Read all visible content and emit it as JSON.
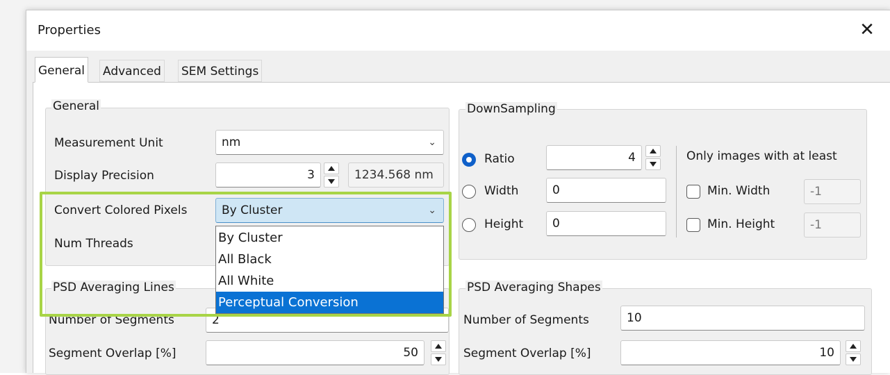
{
  "dialog": {
    "title": "Properties",
    "close_glyph": "✕"
  },
  "tabs": [
    {
      "label": "General",
      "active": true
    },
    {
      "label": "Advanced",
      "active": false
    },
    {
      "label": "SEM Settings",
      "active": false
    }
  ],
  "general_group": {
    "legend": "General",
    "measurement_unit": {
      "label": "Measurement Unit",
      "value": "nm"
    },
    "display_precision": {
      "label": "Display Precision",
      "value": "3",
      "preview": "1234.568 nm"
    },
    "convert_colored_pixels": {
      "label": "Convert Colored Pixels",
      "value": "By Cluster",
      "options": [
        "By Cluster",
        "All Black",
        "All White",
        "Perceptual Conversion"
      ],
      "highlighted_option": "Perceptual Conversion"
    },
    "num_threads": {
      "label": "Num Threads"
    }
  },
  "downsampling_group": {
    "legend": "DownSampling",
    "ratio": {
      "label": "Ratio",
      "value": "4",
      "selected": true
    },
    "width": {
      "label": "Width",
      "value": "0",
      "selected": false
    },
    "height": {
      "label": "Height",
      "value": "0",
      "selected": false
    },
    "only_images_label": "Only images with at least",
    "min_width": {
      "label": "Min. Width",
      "value": "-1",
      "checked": false
    },
    "min_height": {
      "label": "Min. Height",
      "value": "-1",
      "checked": false
    }
  },
  "psd_lines_group": {
    "legend": "PSD Averaging Lines",
    "number_of_segments": {
      "label": "Number of Segments",
      "value": "2"
    },
    "segment_overlap": {
      "label": "Segment Overlap [%]",
      "value": "50"
    }
  },
  "psd_shapes_group": {
    "legend": "PSD Averaging Shapes",
    "number_of_segments": {
      "label": "Number of Segments",
      "value": "10"
    },
    "segment_overlap": {
      "label": "Segment Overlap [%]",
      "value": "10"
    }
  },
  "colors": {
    "accent": "#0f60c9",
    "selection": "#0a72d4",
    "highlight_border": "#a8d447",
    "combo_open_bg": "#cfe6f5"
  }
}
